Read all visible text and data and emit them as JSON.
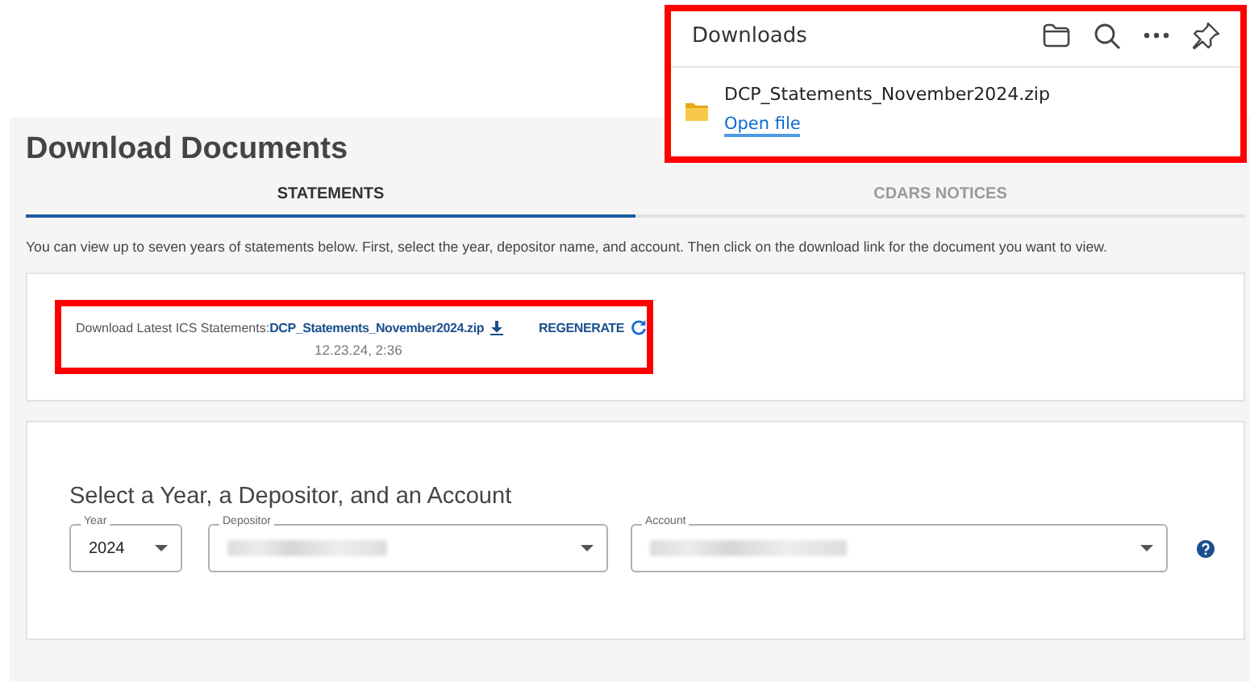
{
  "downloads_panel": {
    "title": "Downloads",
    "highlighted": true,
    "items": [
      {
        "file_name": "DCP_Statements_November2024.zip",
        "action": "Open file"
      }
    ]
  },
  "page": {
    "title": "Download Documents"
  },
  "tabs": [
    {
      "label": "STATEMENTS",
      "selected": true
    },
    {
      "label": "CDARS NOTICES",
      "selected": false
    }
  ],
  "instructions": "You can view up to seven years of statements below. First, select the year, depositor name, and account. Then click on the download link for the document you want to view.",
  "latest_statements": {
    "highlighted": true,
    "label": "Download Latest ICS Statements:",
    "file_link": "DCP_Statements_November2024.zip",
    "regenerate": "REGENERATE",
    "timestamp": "12.23.24, 2:36"
  },
  "selection": {
    "heading": "Select a Year, a Depositor, and an Account",
    "fields": [
      {
        "label": "Year",
        "value": "2024",
        "redacted": false
      },
      {
        "label": "Depositor",
        "redacted": true
      },
      {
        "label": "Account",
        "redacted": true
      }
    ]
  }
}
